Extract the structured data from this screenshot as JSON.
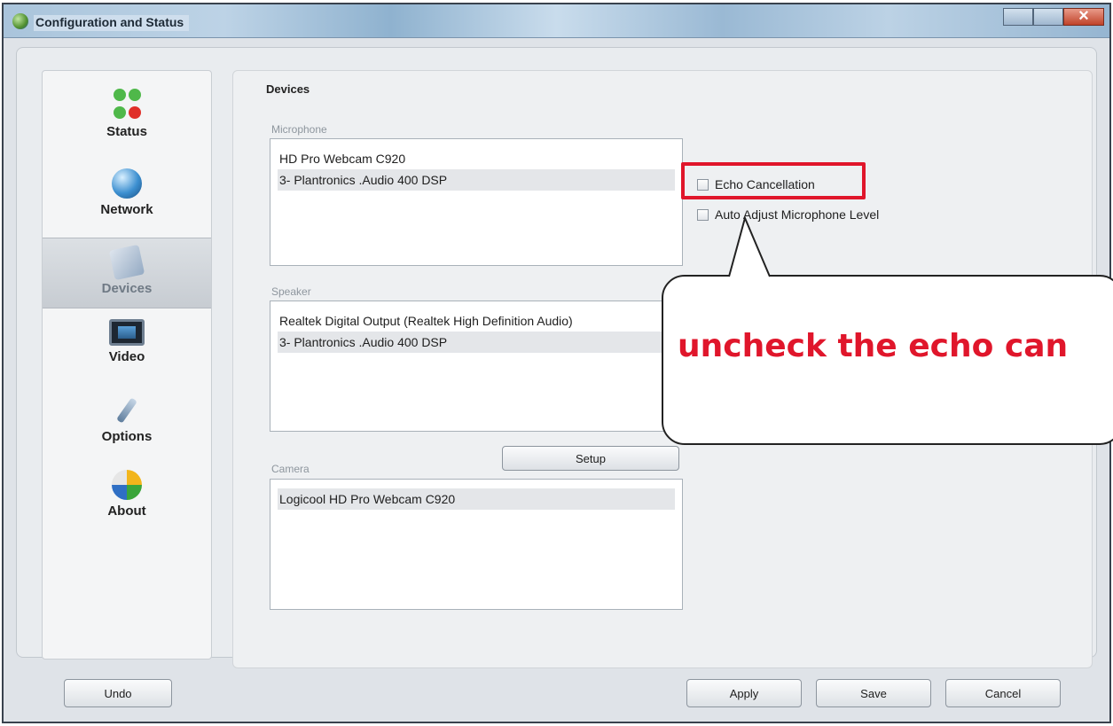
{
  "window": {
    "title": "Configuration and Status"
  },
  "sidebar": {
    "items": [
      {
        "label": "Status",
        "icon": "status-icon",
        "active": false
      },
      {
        "label": "Network",
        "icon": "globe-icon",
        "active": false
      },
      {
        "label": "Devices",
        "icon": "devices-icon",
        "active": true
      },
      {
        "label": "Video",
        "icon": "monitor-icon",
        "active": false
      },
      {
        "label": "Options",
        "icon": "wrench-icon",
        "active": false
      },
      {
        "label": "About",
        "icon": "about-icon",
        "active": false
      }
    ]
  },
  "devices": {
    "section_title": "Devices",
    "microphone": {
      "label": "Microphone",
      "items": [
        "HD Pro Webcam C920",
        "3- Plantronics .Audio 400 DSP"
      ],
      "selected_index": 1
    },
    "echo_cancellation": {
      "label": "Echo Cancellation",
      "checked": false
    },
    "auto_adjust": {
      "label": "Auto Adjust Microphone Level",
      "checked": false
    },
    "speaker": {
      "label": "Speaker",
      "items": [
        "Realtek Digital Output (Realtek High Definition Audio)",
        "3- Plantronics .Audio 400 DSP"
      ],
      "selected_index": 1
    },
    "setup_label": "Setup",
    "camera": {
      "label": "Camera",
      "items": [
        "Logicool HD Pro Webcam C920"
      ],
      "selected_index": 0
    }
  },
  "footer": {
    "undo_label": "Undo",
    "apply_label": "Apply",
    "save_label": "Save",
    "cancel_label": "Cancel"
  },
  "annotation": {
    "callout_text": "uncheck the echo can",
    "highlight_color": "#e0162b"
  }
}
